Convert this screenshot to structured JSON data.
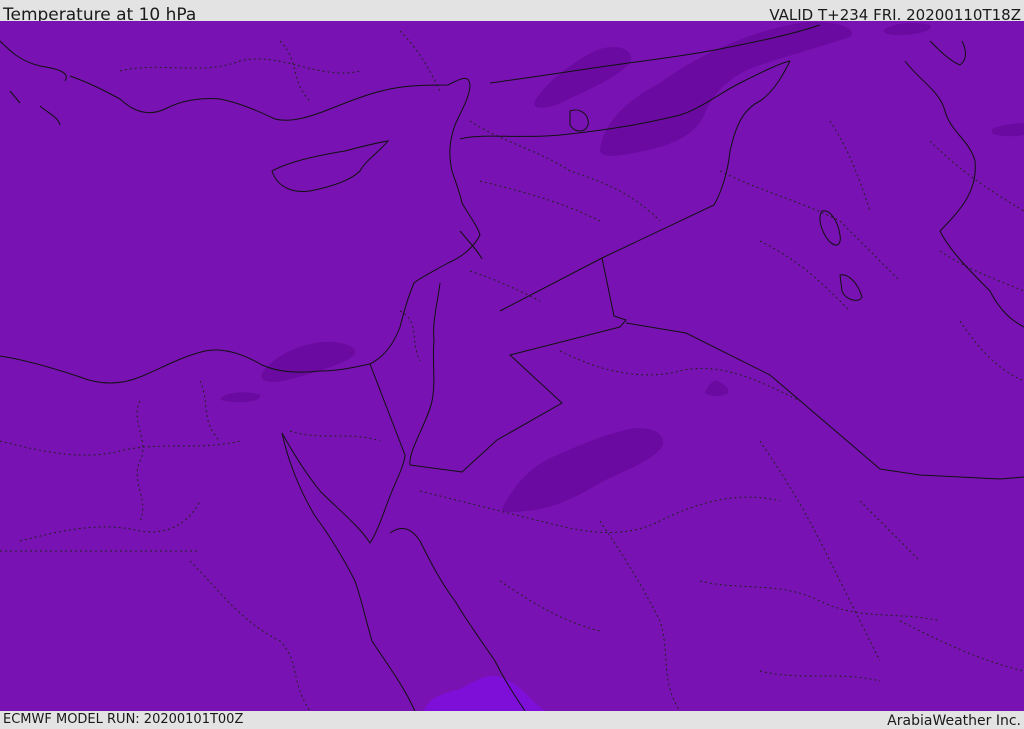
{
  "header": {
    "title": "Temperature at 10 hPa",
    "valid": "VALID T+234 FRI. 20200110T18Z"
  },
  "footer": {
    "model_run": "ECMWF MODEL RUN: 20200101T00Z",
    "credit": "ArabiaWeather Inc."
  },
  "map": {
    "colors": {
      "base_fill": "#7912b2",
      "darker_fill": "#6a0aa0",
      "lighter_fill": "#7d0fd8",
      "coastline": "#111111",
      "country_border": "#111111",
      "province_border": "#222222"
    }
  }
}
